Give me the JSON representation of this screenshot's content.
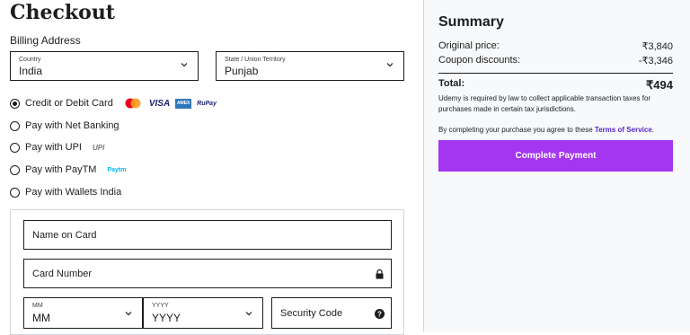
{
  "page": {
    "title": "Checkout"
  },
  "billing": {
    "label": "Billing Address",
    "country": {
      "label": "Country",
      "value": "India"
    },
    "state": {
      "label": "State / Union Territory",
      "value": "Punjab"
    }
  },
  "payment_methods": [
    {
      "label": "Credit or Debit Card",
      "selected": true,
      "logos": [
        "mastercard",
        "VISA",
        "AMEX",
        "RuPay"
      ]
    },
    {
      "label": "Pay with Net Banking",
      "selected": false
    },
    {
      "label": "Pay with UPI",
      "selected": false,
      "logos": [
        "UPI"
      ]
    },
    {
      "label": "Pay with PayTM",
      "selected": false,
      "logos": [
        "Paytm"
      ]
    },
    {
      "label": "Pay with Wallets India",
      "selected": false
    }
  ],
  "card_form": {
    "name_placeholder": "Name on Card",
    "number_placeholder": "Card Number",
    "month": {
      "label": "MM",
      "value": "MM"
    },
    "year": {
      "label": "YYYY",
      "value": "YYYY"
    },
    "security_placeholder": "Security Code"
  },
  "summary": {
    "title": "Summary",
    "original_price": {
      "label": "Original price:",
      "value": "₹3,840"
    },
    "coupon": {
      "label": "Coupon discounts:",
      "value": "-₹3,346"
    },
    "total": {
      "label": "Total:",
      "value": "₹494"
    },
    "tax_note": "Udemy is required by law to collect applicable transaction taxes for purchases made in certain tax jurisdictions.",
    "tos_prefix": "By completing your purchase you agree to these ",
    "tos_link": "Terms of Service",
    "tos_suffix": ".",
    "button_label": "Complete Payment"
  },
  "colors": {
    "accent": "#a435f0",
    "link": "#5624d0",
    "visa": "#1a1f71",
    "amex": "#2e77bc"
  }
}
